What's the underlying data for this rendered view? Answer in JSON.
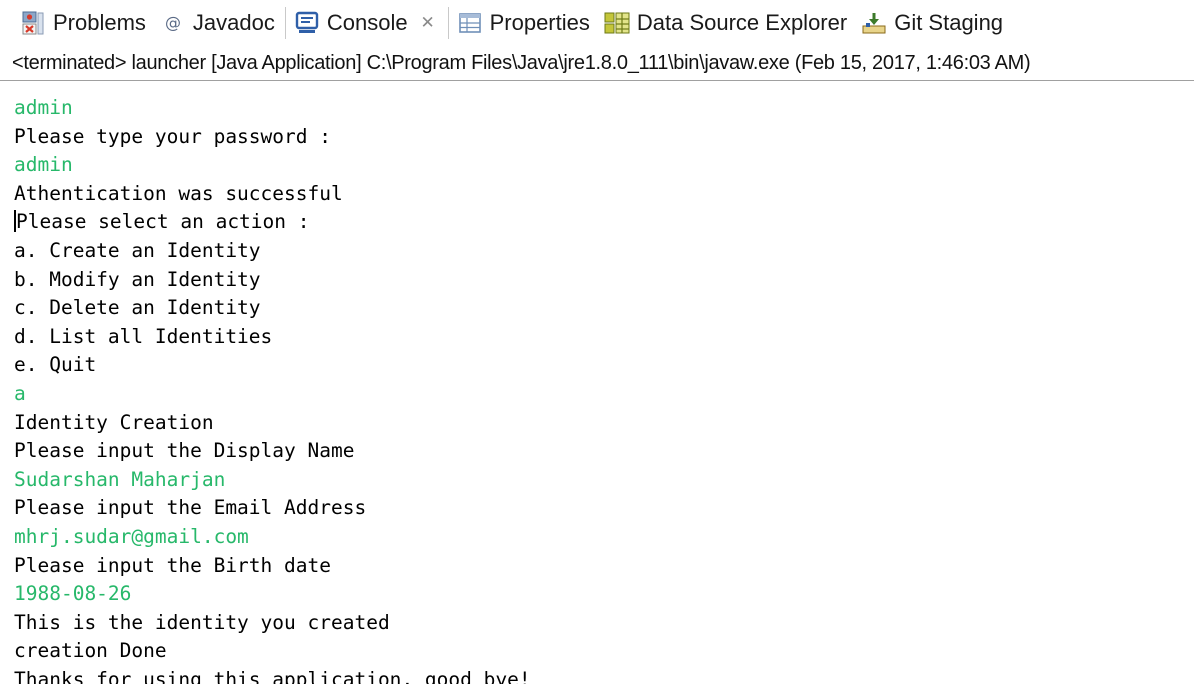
{
  "tabs": [
    {
      "label": "Problems",
      "icon": "problems-icon",
      "active": false
    },
    {
      "label": "Javadoc",
      "icon": "javadoc-icon",
      "active": false
    },
    {
      "label": "Console",
      "icon": "console-icon",
      "active": true,
      "close_glyph": "✕"
    },
    {
      "label": "Properties",
      "icon": "properties-icon",
      "active": false
    },
    {
      "label": "Data Source Explorer",
      "icon": "data-source-explorer-icon",
      "active": false
    },
    {
      "label": "Git Staging",
      "icon": "git-staging-icon",
      "active": false
    }
  ],
  "status_line": "<terminated> launcher [Java Application] C:\\Program Files\\Java\\jre1.8.0_111\\bin\\javaw.exe (Feb 15, 2017, 1:46:03 AM)",
  "colors": {
    "user_input": "#27b86a",
    "program_output": "#000000",
    "console_icon": "#2f5fa8",
    "problems_icon": "#d83a2a",
    "data_source_icon": "#8a9a20",
    "git_icon": "#3c7a2a"
  },
  "console": {
    "lines": [
      {
        "text": "admin",
        "kind": "input"
      },
      {
        "text": "Please type your password :",
        "kind": "output"
      },
      {
        "text": "admin",
        "kind": "input"
      },
      {
        "text": "Athentication was successful",
        "kind": "output"
      },
      {
        "text": "Please select an action :",
        "kind": "output",
        "caret": true
      },
      {
        "text": "a. Create an Identity",
        "kind": "output"
      },
      {
        "text": "b. Modify an Identity",
        "kind": "output"
      },
      {
        "text": "c. Delete an Identity",
        "kind": "output"
      },
      {
        "text": "d. List all Identities",
        "kind": "output"
      },
      {
        "text": "e. Quit",
        "kind": "output"
      },
      {
        "text": "a",
        "kind": "input"
      },
      {
        "text": "Identity Creation",
        "kind": "output"
      },
      {
        "text": "Please input the Display Name",
        "kind": "output"
      },
      {
        "text": "Sudarshan Maharjan",
        "kind": "input"
      },
      {
        "text": "Please input the Email Address",
        "kind": "output"
      },
      {
        "text": "mhrj.sudar@gmail.com",
        "kind": "input"
      },
      {
        "text": "Please input the Birth date",
        "kind": "output"
      },
      {
        "text": "1988-08-26",
        "kind": "input"
      },
      {
        "text": "This is the identity you created",
        "kind": "output"
      },
      {
        "text": "creation Done",
        "kind": "output"
      },
      {
        "text": "Thanks for using this application, good bye!",
        "kind": "output"
      }
    ]
  }
}
